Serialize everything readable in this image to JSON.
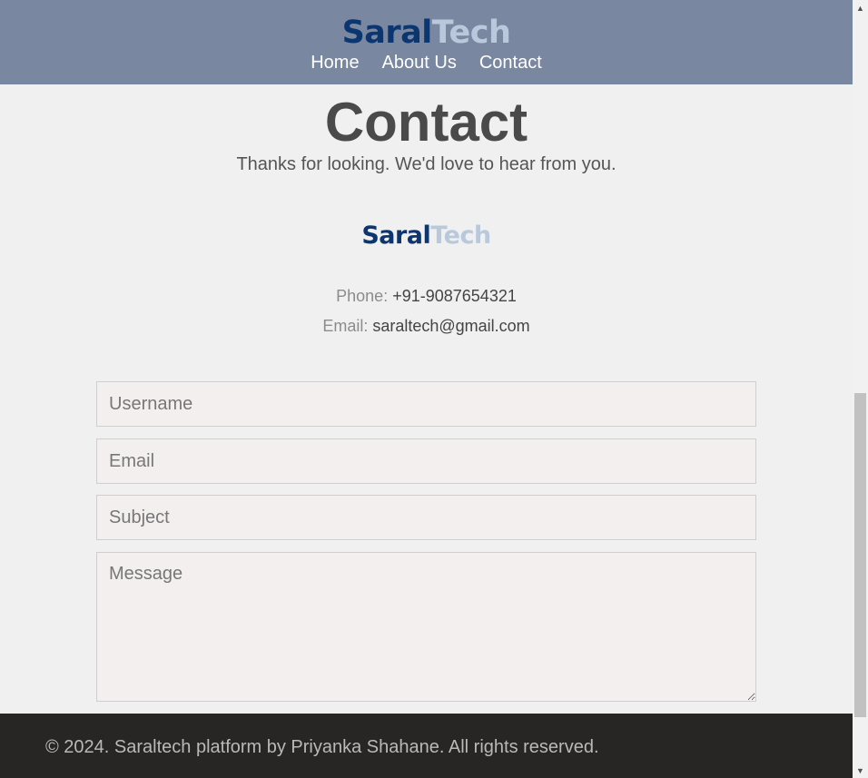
{
  "brand": {
    "part1": "Saral",
    "part2": "Tech",
    "color_primary": "#0c3670",
    "color_secondary": "#b9c9dc"
  },
  "nav": {
    "items": [
      {
        "label": "Home"
      },
      {
        "label": "About Us"
      },
      {
        "label": "Contact"
      }
    ]
  },
  "page": {
    "title": "Contact",
    "subtitle": "Thanks for looking. We'd love to hear from you."
  },
  "contact_info": {
    "phone_label": "Phone:",
    "phone_value": "+91-9087654321",
    "email_label": "Email:",
    "email_value": "saraltech@gmail.com"
  },
  "form": {
    "username_placeholder": "Username",
    "email_placeholder": "Email",
    "subject_placeholder": "Subject",
    "message_placeholder": "Message"
  },
  "footer": {
    "text": "© 2024. Saraltech platform by Priyanka Shahane. All rights reserved."
  },
  "colors": {
    "header_bg": "#7987a0",
    "footer_bg": "#272625",
    "page_bg": "#f0f0f0"
  },
  "icons": {
    "scroll_up": "arrow-up-icon",
    "scroll_down": "arrow-down-icon"
  }
}
